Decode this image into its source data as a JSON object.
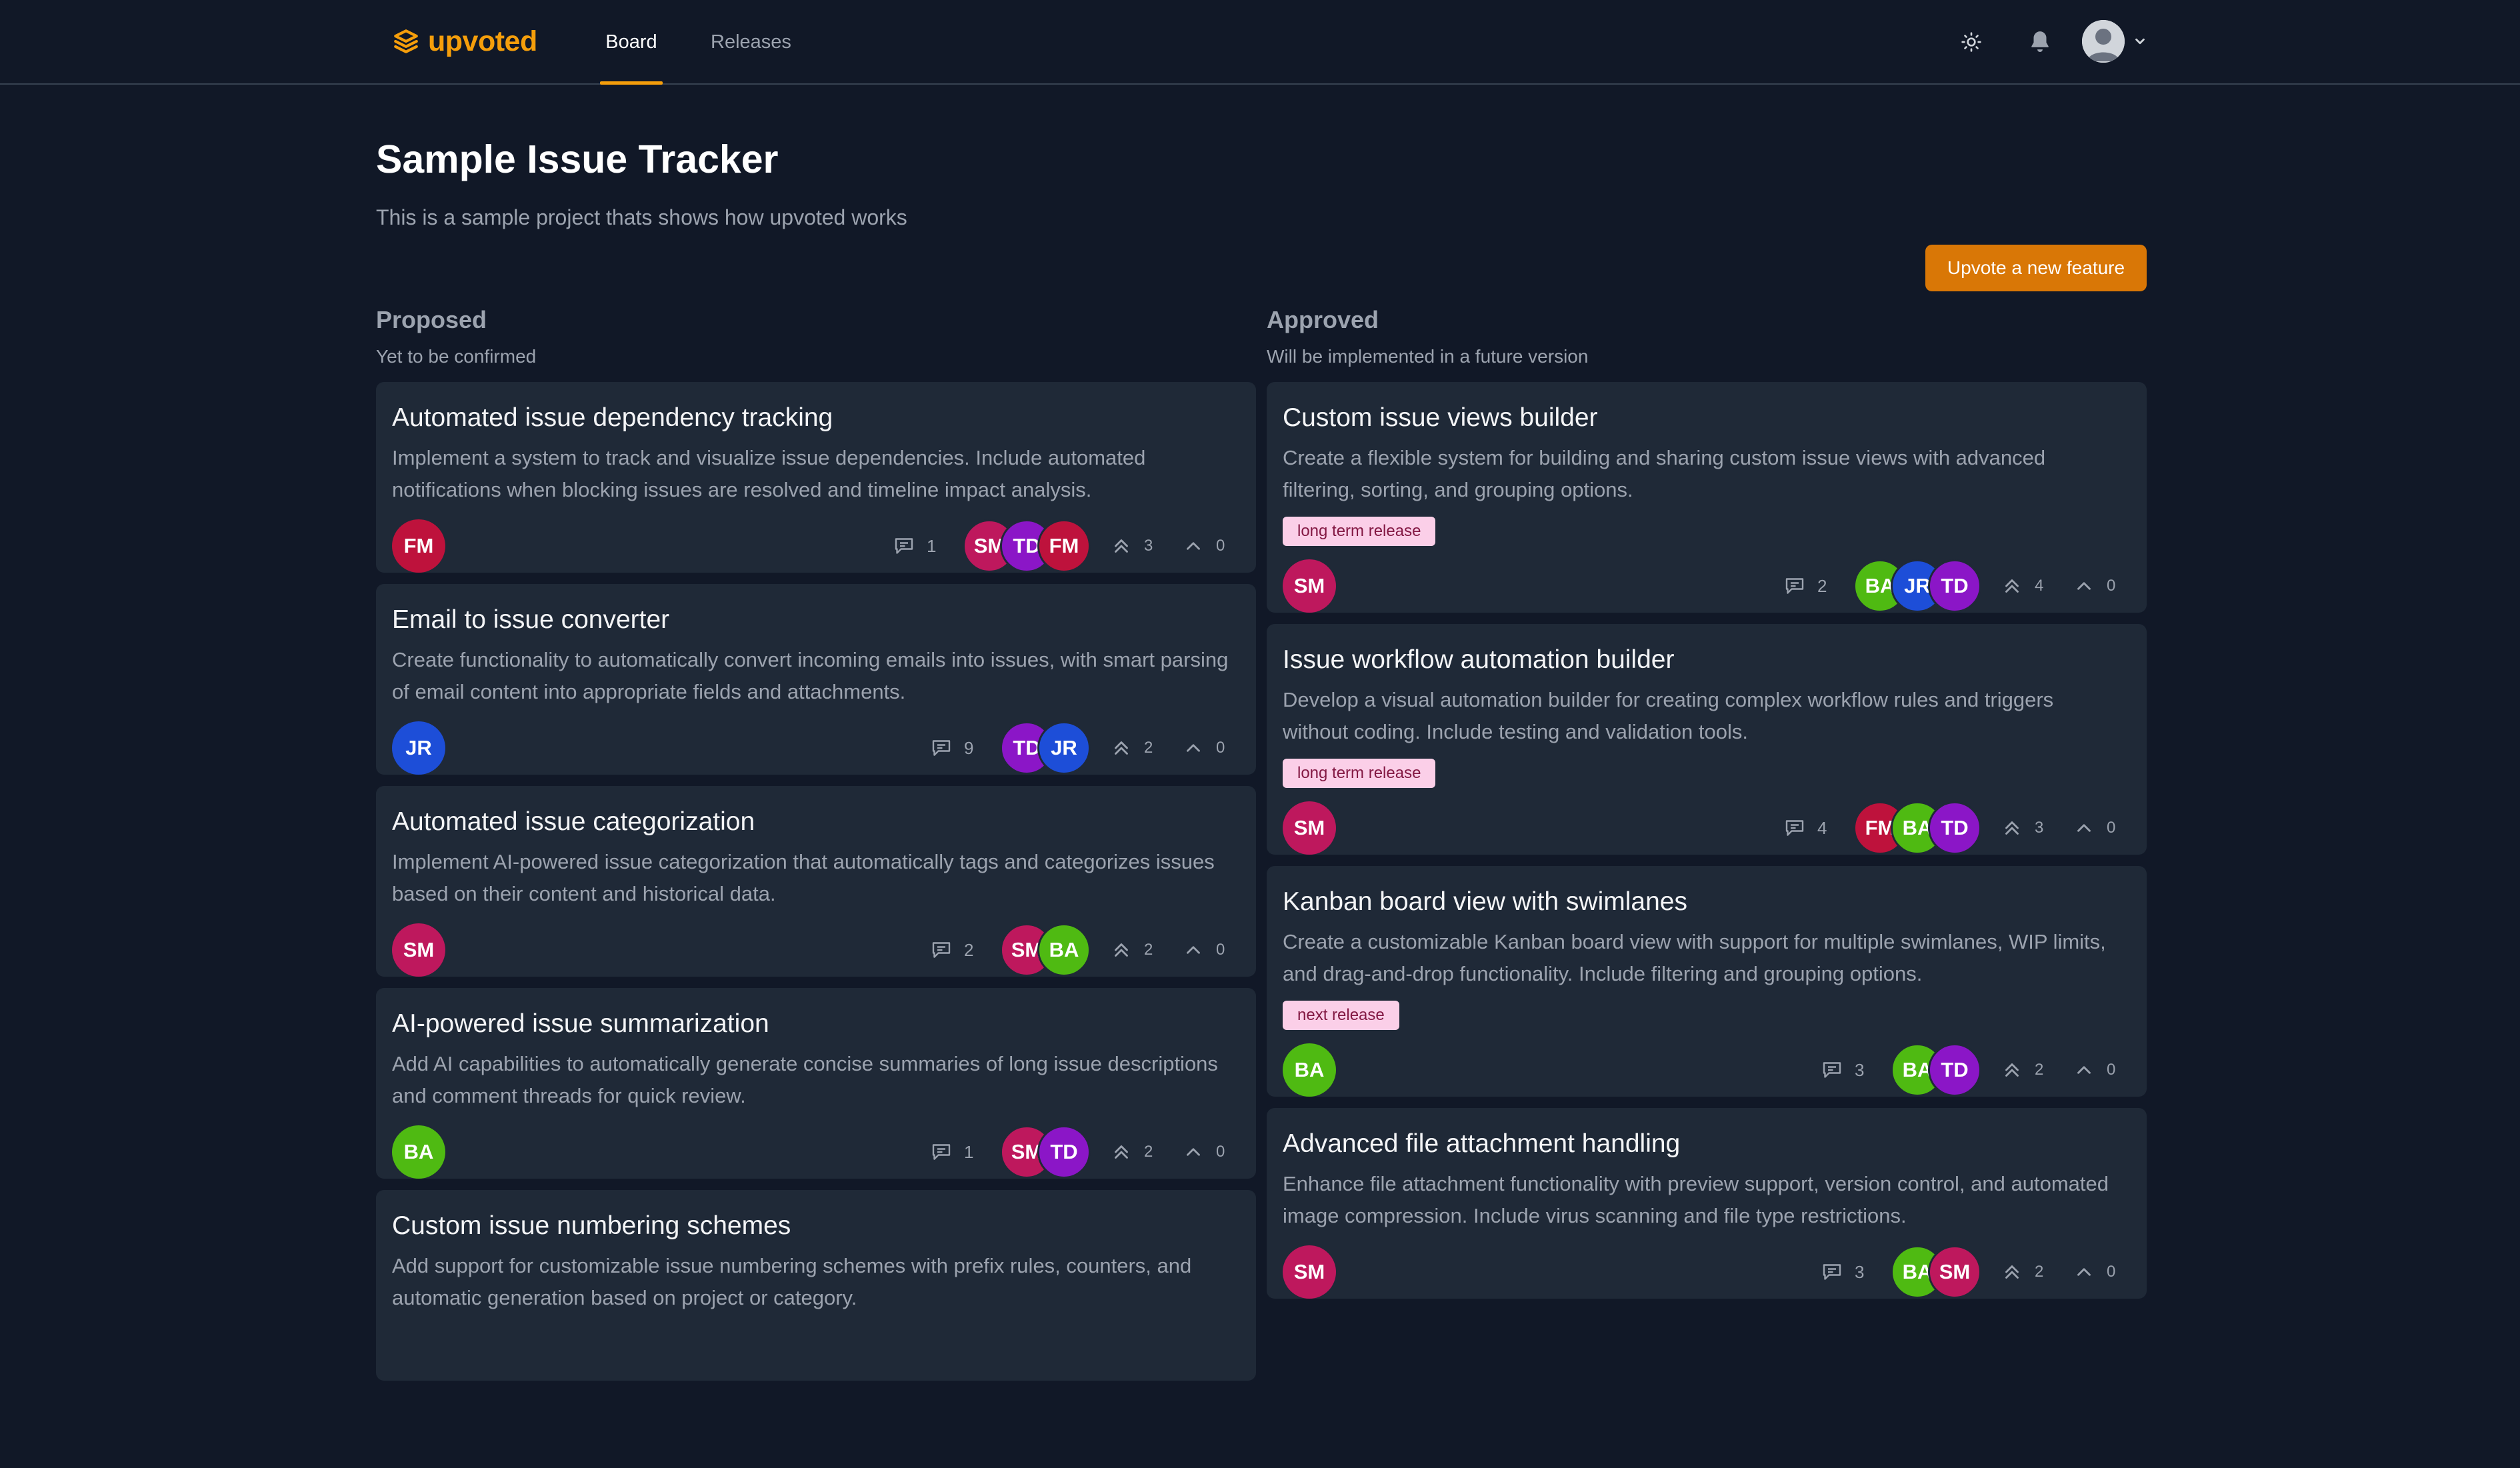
{
  "app": {
    "name": "upvoted"
  },
  "nav": {
    "tabs": [
      {
        "label": "Board",
        "active": true
      },
      {
        "label": "Releases",
        "active": false
      }
    ]
  },
  "page": {
    "title": "Sample Issue Tracker",
    "description": "This is a sample project thats shows how upvoted works",
    "primary_button": "Upvote a new feature"
  },
  "colors": {
    "accent": "#f59e0b",
    "button": "#d97706",
    "background": "#111827",
    "card": "#1f2937",
    "tag_bg": "#fbcfe8"
  },
  "columns": [
    {
      "title": "Proposed",
      "subtitle": "Yet to be confirmed",
      "cards": [
        {
          "title": "Automated issue dependency tracking",
          "description": "Implement a system to track and visualize issue dependencies. Include automated notifications when blocking issues are resolved and timeline impact analysis.",
          "tag": "",
          "author": "FM",
          "comments": "1",
          "voters": [
            "SM",
            "TD",
            "FM"
          ],
          "upvotes": "3",
          "votes": "0"
        },
        {
          "title": "Email to issue converter",
          "description": "Create functionality to automatically convert incoming emails into issues, with smart parsing of email content into appropriate fields and attachments.",
          "tag": "",
          "author": "JR",
          "comments": "9",
          "voters": [
            "TD",
            "JR"
          ],
          "upvotes": "2",
          "votes": "0"
        },
        {
          "title": "Automated issue categorization",
          "description": "Implement AI-powered issue categorization that automatically tags and categorizes issues based on their content and historical data.",
          "tag": "",
          "author": "SM",
          "comments": "2",
          "voters": [
            "SM",
            "BA"
          ],
          "upvotes": "2",
          "votes": "0"
        },
        {
          "title": "AI-powered issue summarization",
          "description": "Add AI capabilities to automatically generate concise summaries of long issue descriptions and comment threads for quick review.",
          "tag": "",
          "author": "BA",
          "comments": "1",
          "voters": [
            "SM",
            "TD"
          ],
          "upvotes": "2",
          "votes": "0"
        },
        {
          "title": "Custom issue numbering schemes",
          "description": "Add support for customizable issue numbering schemes with prefix rules, counters, and automatic generation based on project or category.",
          "tag": "",
          "author": "",
          "comments": "",
          "voters": [],
          "upvotes": "",
          "votes": ""
        }
      ]
    },
    {
      "title": "Approved",
      "subtitle": "Will be implemented in a future version",
      "cards": [
        {
          "title": "Custom issue views builder",
          "description": "Create a flexible system for building and sharing custom issue views with advanced filtering, sorting, and grouping options.",
          "tag": "long term release",
          "author": "SM",
          "comments": "2",
          "voters": [
            "BA",
            "JR",
            "TD"
          ],
          "upvotes": "4",
          "votes": "0"
        },
        {
          "title": "Issue workflow automation builder",
          "description": "Develop a visual automation builder for creating complex workflow rules and triggers without coding. Include testing and validation tools.",
          "tag": "long term release",
          "author": "SM",
          "comments": "4",
          "voters": [
            "FM",
            "BA",
            "TD"
          ],
          "upvotes": "3",
          "votes": "0"
        },
        {
          "title": "Kanban board view with swimlanes",
          "description": "Create a customizable Kanban board view with support for multiple swimlanes, WIP limits, and drag-and-drop functionality. Include filtering and grouping options.",
          "tag": "next release",
          "author": "BA",
          "comments": "3",
          "voters": [
            "BA",
            "TD"
          ],
          "upvotes": "2",
          "votes": "0"
        },
        {
          "title": "Advanced file attachment handling",
          "description": "Enhance file attachment functionality with preview support, version control, and automated image compression. Include virus scanning and file type restrictions.",
          "tag": "",
          "author": "SM",
          "comments": "3",
          "voters": [
            "BA",
            "SM"
          ],
          "upvotes": "2",
          "votes": "0"
        }
      ]
    }
  ]
}
